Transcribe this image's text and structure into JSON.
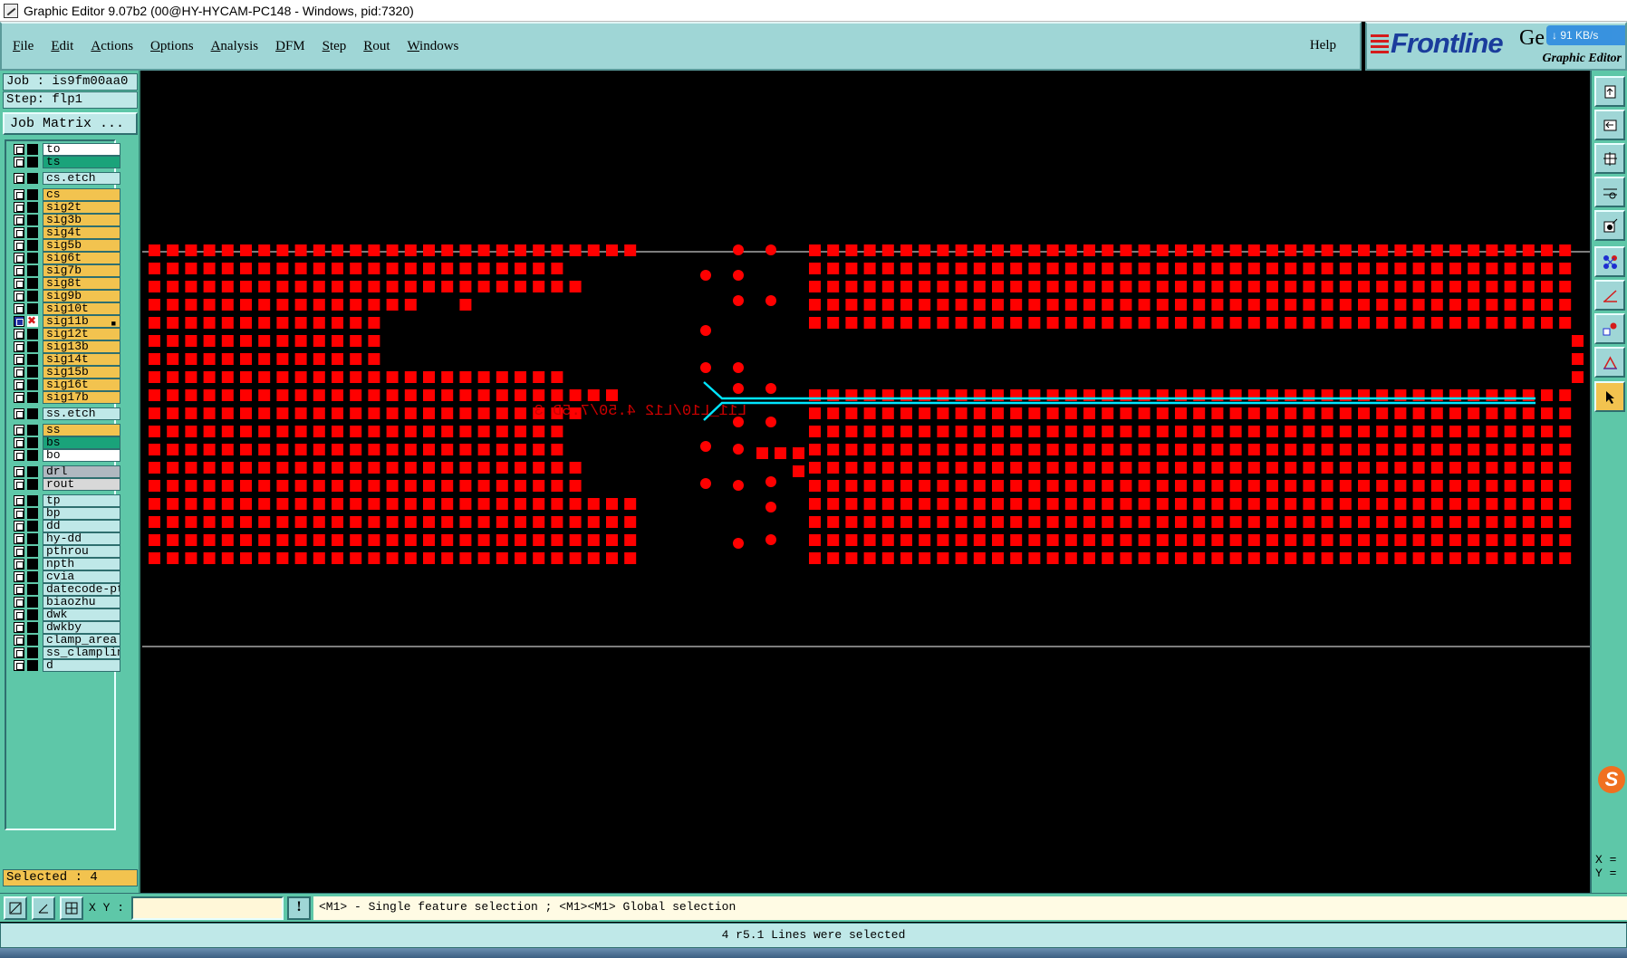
{
  "window": {
    "title": "Graphic Editor 9.07b2 (00@HY-HYCAM-PC148 - Windows, pid:7320)"
  },
  "menu": {
    "items": [
      "File",
      "Edit",
      "Actions",
      "Options",
      "Analysis",
      "DFM",
      "Step",
      "Rout",
      "Windows"
    ],
    "help": "Help"
  },
  "brand": {
    "logo": "Frontline",
    "product_partial": "Ge",
    "subtitle": "Graphic Editor",
    "network_badge": "↓ 91 KB/s"
  },
  "job": {
    "job_label": "Job : is9fm00aa0",
    "step_label": "Step: flp1",
    "matrix_button": "Job Matrix ..."
  },
  "layers": [
    {
      "name": "to",
      "color": "#ffffff",
      "group": 0
    },
    {
      "name": "ts",
      "color": "#1aa37a",
      "group": 0
    },
    {
      "name": "cs.etch",
      "color": "#bfe8e8",
      "group": 1
    },
    {
      "name": "cs",
      "color": "#f2c34f",
      "group": 2
    },
    {
      "name": "sig2t",
      "color": "#f2c34f",
      "group": 2
    },
    {
      "name": "sig3b",
      "color": "#f2c34f",
      "group": 2
    },
    {
      "name": "sig4t",
      "color": "#f2c34f",
      "group": 2
    },
    {
      "name": "sig5b",
      "color": "#f2c34f",
      "group": 2
    },
    {
      "name": "sig6t",
      "color": "#f2c34f",
      "group": 2
    },
    {
      "name": "sig7b",
      "color": "#f2c34f",
      "group": 2
    },
    {
      "name": "sig8t",
      "color": "#f2c34f",
      "group": 2
    },
    {
      "name": "sig9b",
      "color": "#f2c34f",
      "group": 2
    },
    {
      "name": "sig10t",
      "color": "#f2c34f",
      "group": 2
    },
    {
      "name": "sig11b",
      "color": "#f2c34f",
      "group": 2,
      "active": true
    },
    {
      "name": "sig12t",
      "color": "#f2c34f",
      "group": 2
    },
    {
      "name": "sig13b",
      "color": "#f2c34f",
      "group": 2
    },
    {
      "name": "sig14t",
      "color": "#f2c34f",
      "group": 2
    },
    {
      "name": "sig15b",
      "color": "#f2c34f",
      "group": 2
    },
    {
      "name": "sig16t",
      "color": "#f2c34f",
      "group": 2
    },
    {
      "name": "sig17b",
      "color": "#f2c34f",
      "group": 2
    },
    {
      "name": "ss.etch",
      "color": "#bfe8e8",
      "group": 3
    },
    {
      "name": "ss",
      "color": "#f2c34f",
      "group": 4
    },
    {
      "name": "bs",
      "color": "#1aa37a",
      "group": 4
    },
    {
      "name": "bo",
      "color": "#ffffff",
      "group": 4
    },
    {
      "name": "drl",
      "color": "#b0b8c0",
      "group": 5
    },
    {
      "name": "rout",
      "color": "#d8d8d8",
      "group": 5
    },
    {
      "name": "tp",
      "color": "#bfe8e8",
      "group": 6
    },
    {
      "name": "bp",
      "color": "#bfe8e8",
      "group": 6
    },
    {
      "name": "dd",
      "color": "#bfe8e8",
      "group": 6
    },
    {
      "name": "hy-dd",
      "color": "#bfe8e8",
      "group": 6
    },
    {
      "name": "pthrou",
      "color": "#bfe8e8",
      "group": 6
    },
    {
      "name": "npth",
      "color": "#bfe8e8",
      "group": 6
    },
    {
      "name": "cvia",
      "color": "#bfe8e8",
      "group": 6
    },
    {
      "name": "datecode-pte",
      "color": "#bfe8e8",
      "group": 6
    },
    {
      "name": "biaozhu",
      "color": "#bfe8e8",
      "group": 6
    },
    {
      "name": "dwk",
      "color": "#bfe8e8",
      "group": 6
    },
    {
      "name": "dwkby",
      "color": "#bfe8e8",
      "group": 6
    },
    {
      "name": "clamp_area",
      "color": "#bfe8e8",
      "group": 6
    },
    {
      "name": "ss_clampline",
      "color": "#bfe8e8",
      "group": 6
    },
    {
      "name": "d",
      "color": "#bfe8e8",
      "group": 6
    }
  ],
  "selection": {
    "label": "Selected : 4"
  },
  "canvas": {
    "annotation": "L11_L10/L12 4.50/7.5D 3",
    "pad_color": "#ff0000",
    "trace_color": "#00e5ff",
    "frame_color": "#c8c8c8"
  },
  "right_tools": [
    {
      "name": "top-view-icon"
    },
    {
      "name": "back-view-icon"
    },
    {
      "name": "fit-window-icon"
    },
    {
      "name": "measure-icon"
    },
    {
      "name": "snap-icon"
    },
    {
      "name": "connect-icon"
    },
    {
      "name": "line-draw-icon"
    },
    {
      "name": "feature-icon"
    },
    {
      "name": "triangle-tool-icon"
    },
    {
      "name": "pointer-select-icon",
      "active": true
    }
  ],
  "coords": {
    "x_label": "X =",
    "y_label": "Y ="
  },
  "command": {
    "xy_label": "X Y :",
    "xy_value": "",
    "warn": "!",
    "hint": "<M1> - Single feature selection ; <M1><M1> Global selection"
  },
  "status": {
    "message": "4 r5.1 Lines were selected"
  }
}
